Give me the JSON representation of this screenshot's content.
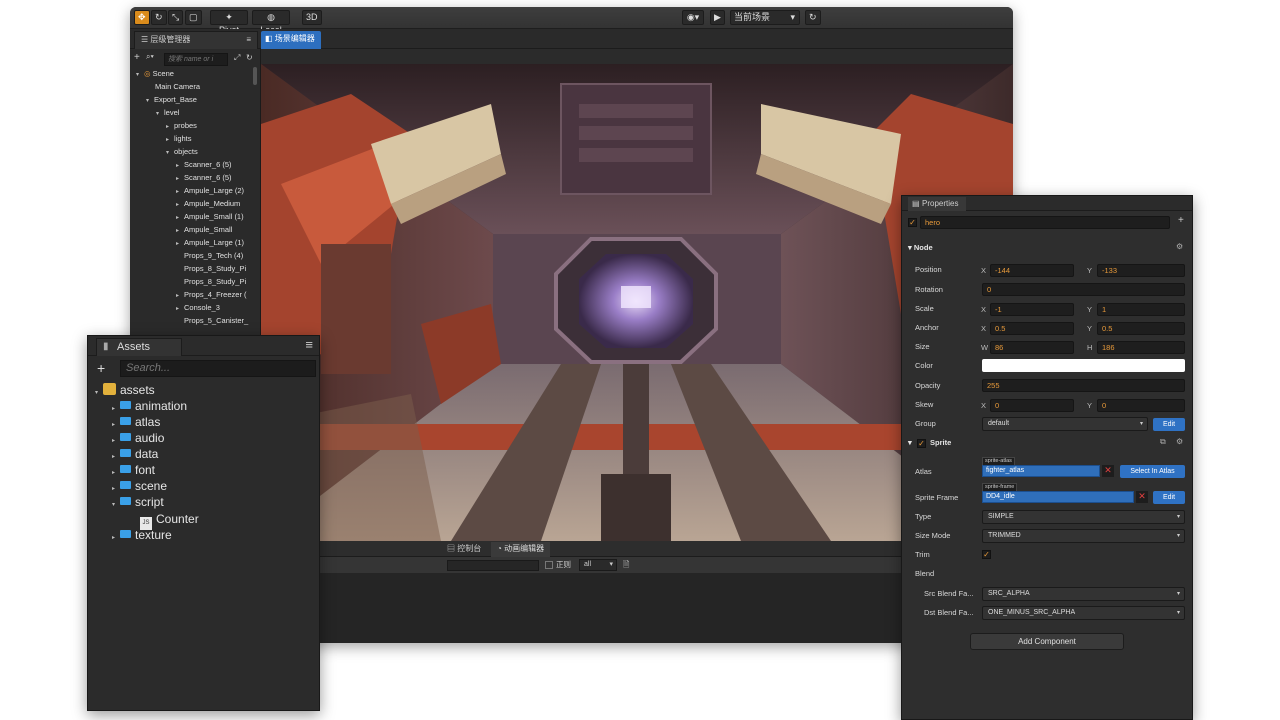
{
  "toolbar": {
    "pivot_label": "Pivot",
    "local_label": "Local",
    "mode_3d_label": "3D",
    "scene_dropdown": "当前场景"
  },
  "hierarchy": {
    "tab_label": "层级管理器",
    "search_placeholder": "搜索 name or i",
    "items": [
      {
        "label": "Scene"
      },
      {
        "label": "Main Camera"
      },
      {
        "label": "Export_Base"
      },
      {
        "label": "level"
      },
      {
        "label": "probes"
      },
      {
        "label": "lights"
      },
      {
        "label": "objects"
      },
      {
        "label": "Scanner_6 (5)"
      },
      {
        "label": "Scanner_6 (5)"
      },
      {
        "label": "Ampule_Large (2)"
      },
      {
        "label": "Ampule_Medium"
      },
      {
        "label": "Ampule_Small (1)"
      },
      {
        "label": "Ampule_Small"
      },
      {
        "label": "Ampule_Large (1)"
      },
      {
        "label": "Props_9_Tech (4)"
      },
      {
        "label": "Props_8_Study_Pi"
      },
      {
        "label": "Props_8_Study_Pi"
      },
      {
        "label": "Props_4_Freezer ("
      },
      {
        "label": "Console_3"
      },
      {
        "label": "Props_5_Canister_"
      }
    ]
  },
  "scene_tab_label": "场景编辑器",
  "console": {
    "tab_console": "控制台",
    "tab_animation": "动画编辑器",
    "regex_label": "正则",
    "level_select": "all"
  },
  "assets": {
    "title": "Assets",
    "search_placeholder": "Search...",
    "root": "assets",
    "items": [
      {
        "label": "animation"
      },
      {
        "label": "atlas"
      },
      {
        "label": "audio"
      },
      {
        "label": "data"
      },
      {
        "label": "font"
      },
      {
        "label": "scene"
      },
      {
        "label": "script"
      },
      {
        "label": "Counter"
      },
      {
        "label": "texture"
      }
    ]
  },
  "properties": {
    "tab_label": "Properties",
    "node_name": "hero",
    "node_section": "Node",
    "labels": {
      "position": "Position",
      "rotation": "Rotation",
      "scale": "Scale",
      "anchor": "Anchor",
      "size": "Size",
      "color": "Color",
      "opacity": "Opacity",
      "skew": "Skew",
      "group": "Group"
    },
    "axis": {
      "x": "X",
      "y": "Y",
      "w": "W",
      "h": "H"
    },
    "values": {
      "position_x": "-144",
      "position_y": "-133",
      "rotation": "0",
      "scale_x": "-1",
      "scale_y": "1",
      "anchor_x": "0.5",
      "anchor_y": "0.5",
      "size_w": "86",
      "size_h": "186",
      "opacity": "255",
      "skew_x": "0",
      "skew_y": "0",
      "group": "default"
    },
    "edit_label": "Edit",
    "sprite_section": "Sprite",
    "atlas_label": "Atlas",
    "atlas_tag": "sprite-atlas",
    "atlas_value": "fighter_atlas",
    "select_in_atlas": "Select In Atlas",
    "sprite_frame_label": "Sprite Frame",
    "sprite_frame_tag": "sprite-frame",
    "sprite_frame_value": "DD4_idle",
    "type_label": "Type",
    "type_value": "SIMPLE",
    "size_mode_label": "Size Mode",
    "size_mode_value": "TRIMMED",
    "trim_label": "Trim",
    "blend_label": "Blend",
    "src_blend_label": "Src Blend Fa...",
    "src_blend_value": "SRC_ALPHA",
    "dst_blend_label": "Dst Blend Fa...",
    "dst_blend_value": "ONE_MINUS_SRC_ALPHA",
    "add_component": "Add Component"
  },
  "colors": {
    "accent_orange": "#d98b1c",
    "accent_blue": "#2f72c4",
    "folder_blue": "#3aa0e8",
    "panel_bg": "#2b2b2b"
  }
}
